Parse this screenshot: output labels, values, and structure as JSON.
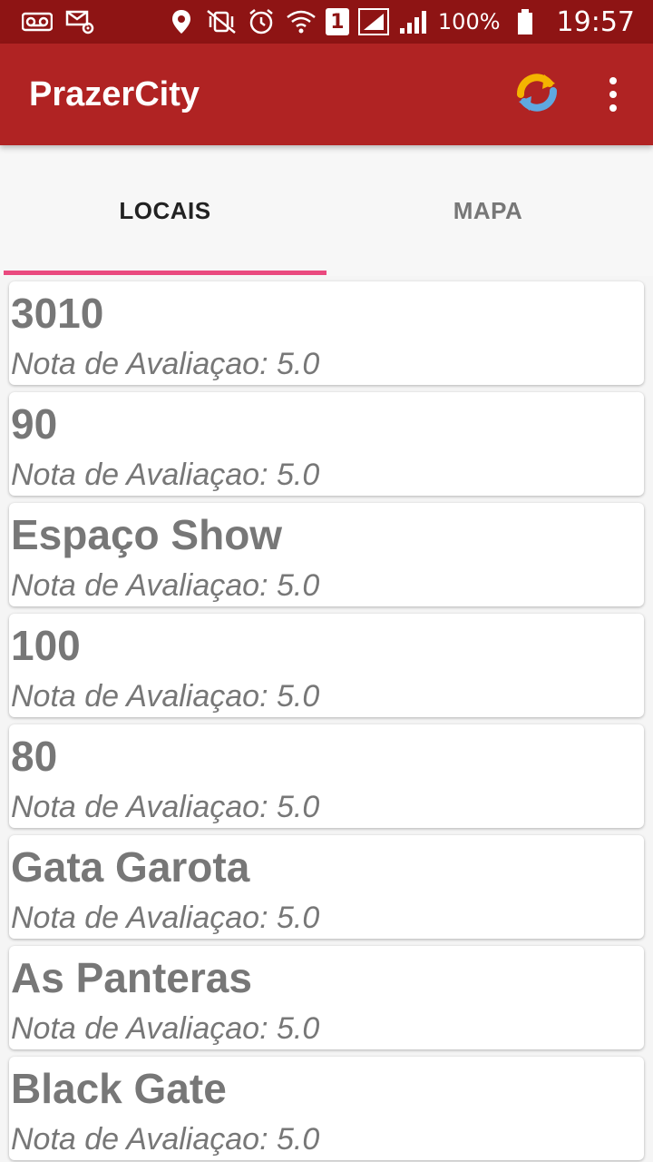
{
  "status_bar": {
    "battery": "100%",
    "time": "19:57",
    "sim": "1"
  },
  "app_bar": {
    "title": "PrazerCity"
  },
  "tabs": [
    {
      "label": "LOCAIS",
      "selected": true
    },
    {
      "label": "MAPA",
      "selected": false
    }
  ],
  "colors": {
    "status_bar": "#8e1414",
    "app_bar": "#b02323",
    "tab_indicator": "#ea4a7f"
  },
  "places": [
    {
      "name": "3010",
      "rating": "Nota de Avaliaçao: 5.0"
    },
    {
      "name": "90",
      "rating": "Nota de Avaliaçao: 5.0"
    },
    {
      "name": "Espaço Show",
      "rating": "Nota de Avaliaçao: 5.0"
    },
    {
      "name": "100",
      "rating": "Nota de Avaliaçao: 5.0"
    },
    {
      "name": "80",
      "rating": "Nota de Avaliaçao: 5.0"
    },
    {
      "name": "Gata Garota",
      "rating": "Nota de Avaliaçao: 5.0"
    },
    {
      "name": "As Panteras",
      "rating": "Nota de Avaliaçao: 5.0"
    },
    {
      "name": "Black Gate",
      "rating": "Nota de Avaliaçao: 5.0"
    }
  ]
}
